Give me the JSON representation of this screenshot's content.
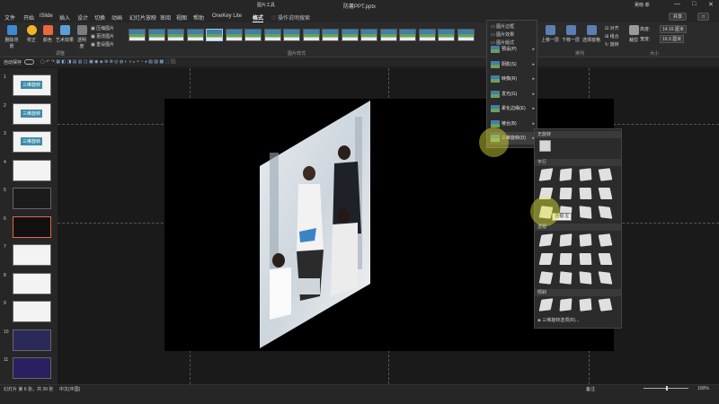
{
  "titlebar": {
    "context_label": "图片工具",
    "doc_title": "防薯PPT.pptx",
    "user": "吴晓·菲",
    "min": "—",
    "max": "□",
    "close": "✕"
  },
  "tabs": [
    "文件",
    "开始",
    "iSlide",
    "插入",
    "设计",
    "切换",
    "动画",
    "幻灯片放映",
    "审阅",
    "视图",
    "帮助",
    "OneKey Lite",
    "格式"
  ],
  "active_tab": "格式",
  "search_placeholder": "操作说明搜索",
  "top_buttons": {
    "share": "共享",
    "comment": "□"
  },
  "ribbon": {
    "buttons": [
      {
        "label": "删除背景",
        "color": "#3e8ad1"
      },
      {
        "label": "校正",
        "color": "#f0b429"
      },
      {
        "label": "颜色",
        "color": "#e86a3a"
      },
      {
        "label": "艺术效果",
        "color": "#5aa0d6"
      },
      {
        "label": "透明度",
        "color": "#7d7d7d"
      }
    ],
    "adjust_small": [
      "压缩图片",
      "更改图片",
      "重设图片"
    ],
    "group_adjust": "调整",
    "group_styles": "图片样式",
    "styles_count": 18,
    "picture_options": [
      "图片边框",
      "图片效果",
      "图片版式"
    ],
    "arrange_buttons": [
      "上移一层",
      "下移一层",
      "选择窗格"
    ],
    "arrange_small": [
      "对齐",
      "组合",
      "旋转"
    ],
    "group_arrange": "排列",
    "crop_label": "裁剪",
    "height_label": "高度:",
    "height_value": "14.16 厘米",
    "width_label": "宽度:",
    "width_value": "16.9 厘米",
    "group_size": "大小"
  },
  "qat": {
    "autosave": "自动保存"
  },
  "thumbnails": [
    {
      "num": "1",
      "title": "三维旋转"
    },
    {
      "num": "2",
      "title": "三维旋转"
    },
    {
      "num": "3",
      "title": "三维旋转"
    },
    {
      "num": "4",
      "title": ""
    },
    {
      "num": "5",
      "title": ""
    },
    {
      "num": "6",
      "title": ""
    },
    {
      "num": "7",
      "title": ""
    },
    {
      "num": "8",
      "title": ""
    },
    {
      "num": "9",
      "title": ""
    },
    {
      "num": "10",
      "title": ""
    },
    {
      "num": "11",
      "title": ""
    }
  ],
  "selected_thumb": "6",
  "effects_menu": [
    {
      "label": "预设(P)"
    },
    {
      "label": "阴影(S)"
    },
    {
      "label": "映像(R)"
    },
    {
      "label": "发光(G)"
    },
    {
      "label": "柔化边缘(E)"
    },
    {
      "label": "棱台(B)"
    },
    {
      "label": "三维旋转(D)"
    }
  ],
  "rotation_submenu": {
    "no_rotation": "无旋转",
    "parallel": "平行",
    "perspective": "透视",
    "oblique": "倾斜",
    "options": "三维旋转选项(R)..."
  },
  "tooltip": "透视:左",
  "status": {
    "slide_info": "幻灯片 第 6 张，共 39 张",
    "language": "中文(中国)",
    "notes": "备注",
    "zoom": "100%"
  }
}
